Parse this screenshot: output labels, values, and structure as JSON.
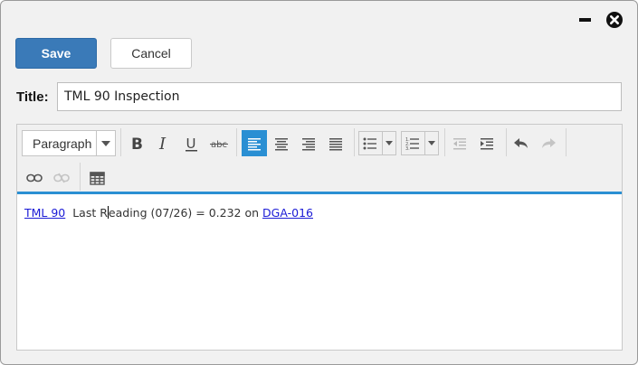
{
  "window": {
    "minimize_icon": "minimize-icon",
    "close_icon": "close-circle-icon"
  },
  "actions": {
    "save_label": "Save",
    "cancel_label": "Cancel",
    "save_color": "#3a7ab8"
  },
  "title": {
    "label": "Title:",
    "value": "TML 90 Inspection"
  },
  "toolbar": {
    "format_select": "Paragraph",
    "buttons": [
      {
        "name": "bold-icon"
      },
      {
        "name": "italic-icon"
      },
      {
        "name": "underline-icon"
      },
      {
        "name": "strikethrough-icon",
        "glyph": "abc"
      },
      {
        "name": "align-left-icon",
        "active": true
      },
      {
        "name": "align-center-icon"
      },
      {
        "name": "align-right-icon"
      },
      {
        "name": "align-justify-icon"
      },
      {
        "name": "bullet-list-icon"
      },
      {
        "name": "numbered-list-icon"
      },
      {
        "name": "outdent-icon",
        "disabled": true
      },
      {
        "name": "indent-icon"
      },
      {
        "name": "undo-icon"
      },
      {
        "name": "redo-icon",
        "disabled": true
      },
      {
        "name": "link-icon"
      },
      {
        "name": "unlink-icon",
        "disabled": true
      },
      {
        "name": "table-icon"
      }
    ],
    "accent_color": "#2a8fd3"
  },
  "content": {
    "link1": "TML 90",
    "text_before_caret": "Last R",
    "text_after_caret": "eading (07/26) = 0.232 on",
    "link2": "DGA-016"
  }
}
